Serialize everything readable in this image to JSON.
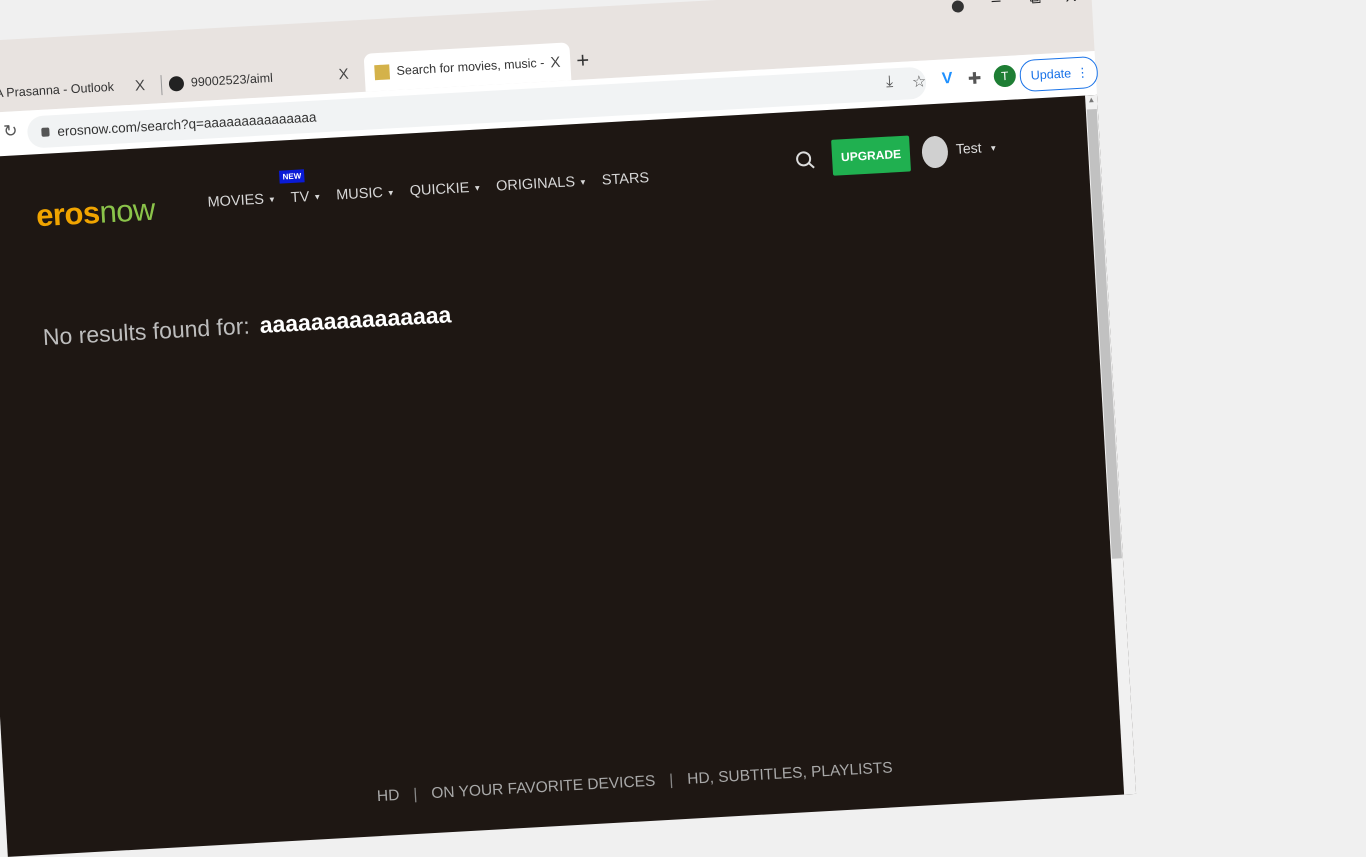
{
  "tabs": [
    {
      "label": "A Prasanna - Outlook",
      "close": "X"
    },
    {
      "label": "99002523/aiml",
      "close": "X"
    },
    {
      "label": "Search for movies, music - Hindi",
      "close": "X"
    }
  ],
  "new_tab": "+",
  "window_controls": {
    "minimize": "–",
    "restore": "⧉",
    "close": "X"
  },
  "toolbar": {
    "url": "erosnow.com/search?q=aaaaaaaaaaaaaaa",
    "profile_initial": "T",
    "update_label": "Update",
    "menu_dots": "⋮"
  },
  "site": {
    "logo_eros": "eros",
    "logo_now": "now",
    "nav": [
      {
        "label": "MOVIES",
        "caret": "▼"
      },
      {
        "label": "TV",
        "caret": "▼",
        "badge": "NEW"
      },
      {
        "label": "MUSIC",
        "caret": "▼"
      },
      {
        "label": "QUICKIE",
        "caret": "▼"
      },
      {
        "label": "ORIGINALS",
        "caret": "▼"
      },
      {
        "label": "STARS",
        "caret": ""
      }
    ],
    "upgrade_label": "UPGRADE",
    "user_name": "Test",
    "user_caret": "▼"
  },
  "results": {
    "label": "No results found for:",
    "query": "aaaaaaaaaaaaaaa"
  },
  "footer": {
    "items": [
      "HD",
      "ON YOUR FAVORITE DEVICES",
      "HD, SUBTITLES, PLAYLISTS"
    ],
    "separator": "|"
  },
  "colors": {
    "brand_orange": "#f0a400",
    "brand_green": "#8bc34a",
    "upgrade_green": "#20b050",
    "page_bg": "#1e1713",
    "new_badge": "#0a1bd6"
  }
}
